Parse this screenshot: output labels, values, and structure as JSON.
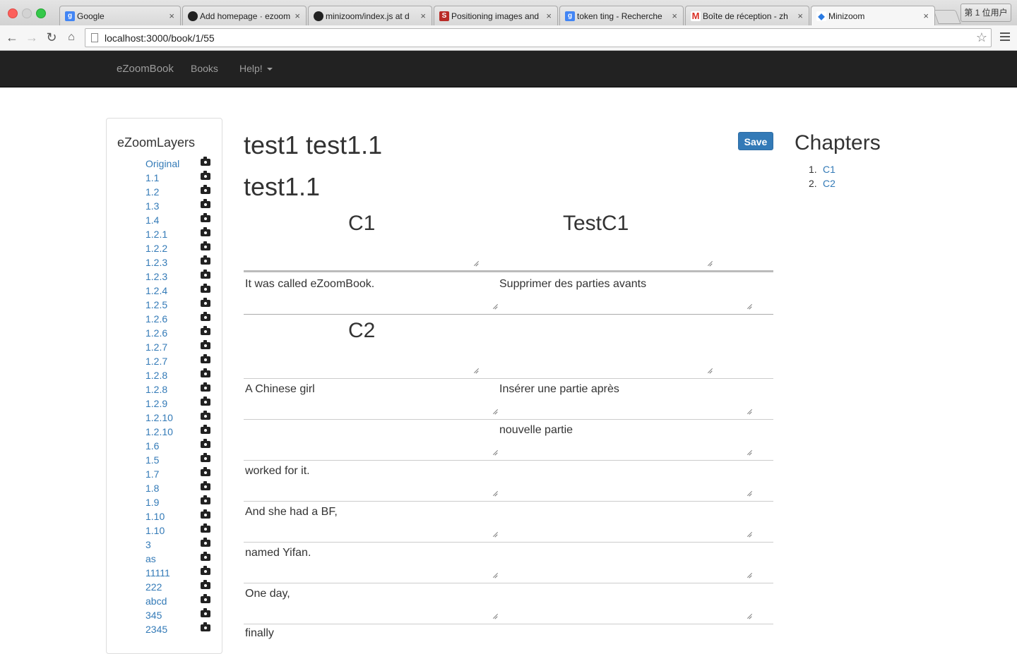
{
  "browser": {
    "tabs": [
      {
        "title": "Google",
        "favicon": "google-icon",
        "color": "#4285f4",
        "active": false
      },
      {
        "title": "Add homepage · ezoom",
        "favicon": "github-icon",
        "color": "#222222",
        "active": false
      },
      {
        "title": "minizoom/index.js at d",
        "favicon": "github-icon",
        "color": "#222222",
        "active": false
      },
      {
        "title": "Positioning images and",
        "favicon": "s-icon",
        "color": "#b92b27",
        "active": false
      },
      {
        "title": "token ting - Recherche",
        "favicon": "google-icon",
        "color": "#4285f4",
        "active": false
      },
      {
        "title": "Boîte de réception - zh",
        "favicon": "gmail-icon",
        "color": "#d93025",
        "active": false
      },
      {
        "title": "Minizoom",
        "favicon": "minizoom-icon",
        "color": "#2a7ae2",
        "active": true
      }
    ],
    "tab_close": "×",
    "profile": "第 1 位用户",
    "url_host": "localhost",
    "url_path": ":3000/book/1/55"
  },
  "navbar": {
    "brand": "eZoomBook",
    "books": "Books",
    "help": "Help!"
  },
  "layers": {
    "title": "eZoomLayers",
    "items": [
      "Original",
      "1.1",
      "1.2",
      "1.3",
      "1.4",
      "1.2.1",
      "1.2.2",
      "1.2.3",
      "1.2.3",
      "1.2.4",
      "1.2.5",
      "1.2.6",
      "1.2.6",
      "1.2.7",
      "1.2.7",
      "1.2.8",
      "1.2.8",
      "1.2.9",
      "1.2.10",
      "1.2.10",
      "1.6",
      "1.5",
      "1.7",
      "1.8",
      "1.9",
      "1.10",
      "1.10",
      "3",
      "as",
      "11111",
      "222",
      "abcd",
      "345",
      "2345"
    ]
  },
  "main": {
    "title": "test1 test1.1",
    "subtitle": "test1.1",
    "save_label": "Save",
    "chapter_headers": [
      {
        "left": "C1",
        "right": "TestC1"
      },
      {
        "left": "C2",
        "right": ""
      }
    ],
    "rows": [
      {
        "left": "It was called eZoomBook.",
        "right": "Supprimer des parties avants"
      },
      {
        "left": "A Chinese girl",
        "right": "Insérer une partie après"
      },
      {
        "left": "",
        "right": "nouvelle partie"
      },
      {
        "left": "worked for it.",
        "right": ""
      },
      {
        "left": "And she had a BF,",
        "right": ""
      },
      {
        "left": "named Yifan.",
        "right": ""
      },
      {
        "left": "One day,",
        "right": ""
      },
      {
        "left": "finally",
        "right": ""
      }
    ]
  },
  "chapters": {
    "title": "Chapters",
    "items": [
      {
        "num": "1.",
        "label": "C1"
      },
      {
        "num": "2.",
        "label": "C2"
      }
    ]
  }
}
